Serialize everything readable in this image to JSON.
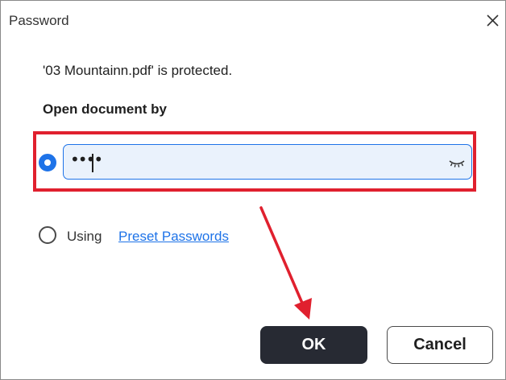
{
  "dialog": {
    "title": "Password",
    "close_icon": "close-icon"
  },
  "message": "'03 Mountainn.pdf' is protected.",
  "section_label": "Open document by",
  "password": {
    "masked_value": "••••",
    "toggle_icon": "eye-closed-icon",
    "selected": true
  },
  "preset": {
    "using_label": "Using",
    "link_label": "Preset Passwords",
    "selected": false
  },
  "buttons": {
    "ok_label": "OK",
    "cancel_label": "Cancel"
  },
  "colors": {
    "accent": "#1e73e8",
    "highlight": "#e0202e",
    "primary_button": "#272a33",
    "field_background": "#eaf2fc"
  }
}
